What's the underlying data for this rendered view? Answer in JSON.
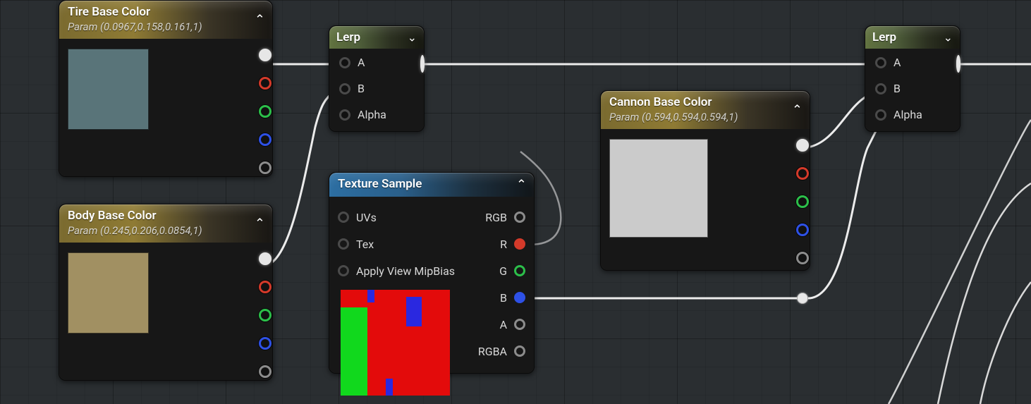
{
  "nodes": {
    "tire": {
      "title": "Tire Base Color",
      "subtitle": "Param (0.0967,0.158,0.161,1)",
      "swatch_color": "#597479"
    },
    "body_color": {
      "title": "Body Base Color",
      "subtitle": "Param (0.245,0.206,0.0854,1)",
      "swatch_color": "#a19062"
    },
    "cannon": {
      "title": "Cannon Base Color",
      "subtitle": "Param (0.594,0.594,0.594,1)",
      "swatch_color": "#cbcbcb"
    },
    "lerp1": {
      "title": "Lerp",
      "inputs": [
        "A",
        "B",
        "Alpha"
      ]
    },
    "lerp2": {
      "title": "Lerp",
      "inputs": [
        "A",
        "B",
        "Alpha"
      ]
    },
    "tex": {
      "title": "Texture Sample",
      "inputs": [
        "UVs",
        "Tex",
        "Apply View MipBias"
      ],
      "outputs": [
        "RGB",
        "R",
        "G",
        "B",
        "A",
        "RGBA"
      ]
    }
  },
  "pin_labels": {
    "a": "A",
    "b": "B",
    "alpha": "Alpha",
    "uvs": "UVs",
    "tex": "Tex",
    "mip": "Apply View MipBias",
    "rgb": "RGB",
    "r": "R",
    "g": "G",
    "bch": "B",
    "ach": "A",
    "rgba": "RGBA"
  },
  "colors": {
    "accent_gold": "#8f7b34",
    "accent_green": "#5a6b3c",
    "accent_blue": "#2c6ea2"
  }
}
